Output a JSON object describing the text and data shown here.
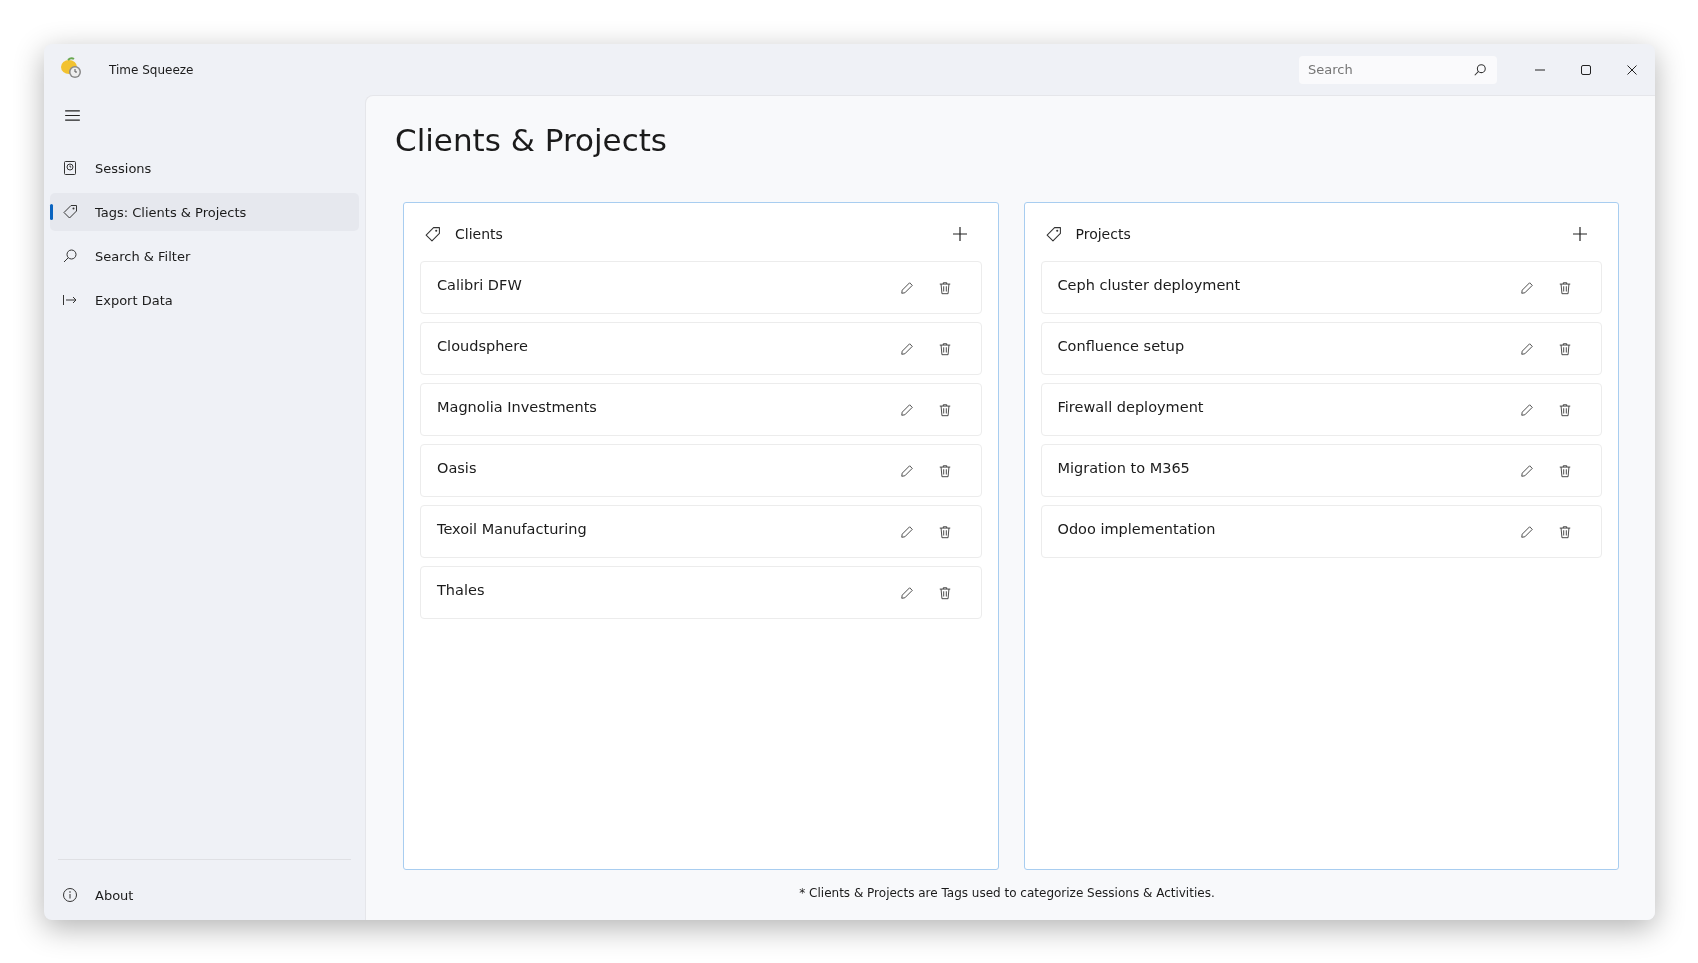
{
  "window": {
    "title": "Time Squeeze"
  },
  "search": {
    "placeholder": "Search"
  },
  "sidebar": {
    "items": [
      {
        "label": "Sessions",
        "kind": "sessions",
        "selected": false
      },
      {
        "label": "Tags: Clients & Projects",
        "kind": "tags",
        "selected": true
      },
      {
        "label": "Search & Filter",
        "kind": "search",
        "selected": false
      },
      {
        "label": "Export Data",
        "kind": "export",
        "selected": false
      }
    ],
    "footer_item": {
      "label": "About"
    }
  },
  "page": {
    "title": "Clients & Projects",
    "panels": [
      {
        "title": "Clients",
        "items": [
          "Calibri DFW",
          "Cloudsphere",
          "Magnolia Investments",
          "Oasis",
          "Texoil Manufacturing",
          "Thales"
        ]
      },
      {
        "title": "Projects",
        "items": [
          "Ceph cluster deployment",
          "Confluence setup",
          "Firewall deployment",
          "Migration to M365",
          "Odoo implementation"
        ]
      }
    ],
    "footnote": "* Clients & Projects are Tags used to categorize Sessions & Activities."
  }
}
